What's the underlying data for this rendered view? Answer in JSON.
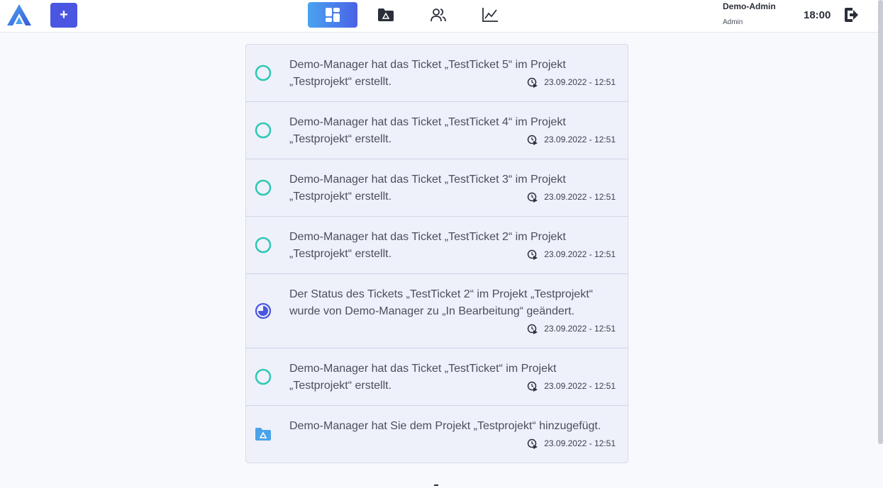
{
  "header": {
    "add_label": "+",
    "nav": [
      {
        "icon": "dashboard-icon",
        "active": true
      },
      {
        "icon": "project-folder-icon",
        "active": false
      },
      {
        "icon": "users-icon",
        "active": false
      },
      {
        "icon": "analytics-chart-icon",
        "active": false
      }
    ],
    "user_name": "Demo-Admin",
    "user_role": "Admin",
    "time": "18:00"
  },
  "colors": {
    "accent": "#4a56e2",
    "open_status": "#2ec8b4",
    "in_progress_status": "#4a56e2",
    "project_icon": "#4aa3e8"
  },
  "feed": {
    "items": [
      {
        "icon": "open-status-icon",
        "text": "Demo-Manager hat das Ticket „TestTicket 5“ im Projekt „Testprojekt“ erstellt.",
        "timestamp": "23.09.2022 - 12:51"
      },
      {
        "icon": "open-status-icon",
        "text": "Demo-Manager hat das Ticket „TestTicket 4“ im Projekt „Testprojekt“ erstellt.",
        "timestamp": "23.09.2022 - 12:51"
      },
      {
        "icon": "open-status-icon",
        "text": "Demo-Manager hat das Ticket „TestTicket 3“ im Projekt „Testprojekt“ erstellt.",
        "timestamp": "23.09.2022 - 12:51"
      },
      {
        "icon": "open-status-icon",
        "text": "Demo-Manager hat das Ticket „TestTicket 2“ im Projekt „Testprojekt“ erstellt.",
        "timestamp": "23.09.2022 - 12:51"
      },
      {
        "icon": "in-progress-status-icon",
        "text": "Der Status des Tickets „TestTicket 2“ im Projekt „Testprojekt“ wurde von Demo-Manager zu „In Bearbeitung“ geändert.",
        "timestamp": "23.09.2022 - 12:51"
      },
      {
        "icon": "open-status-icon",
        "text": "Demo-Manager hat das Ticket „TestTicket“ im Projekt „Testprojekt“ erstellt.",
        "timestamp": "23.09.2022 - 12:51"
      },
      {
        "icon": "project-folder-icon",
        "text": "Demo-Manager hat Sie dem Projekt „Testprojekt“ hinzugefügt.",
        "timestamp": "23.09.2022 - 12:51"
      }
    ]
  }
}
